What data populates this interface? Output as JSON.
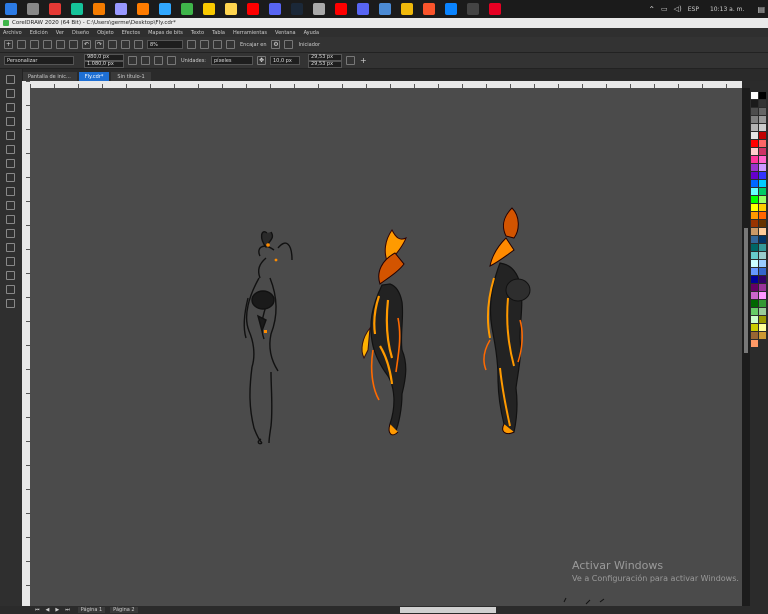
{
  "taskbar": {
    "icons": [
      "windows-icon",
      "search-icon",
      "record-icon",
      "grammarly-icon",
      "blender-icon",
      "after-effects-icon",
      "illustrator-icon",
      "photoshop-icon",
      "coreldraw-icon",
      "file-explorer-icon",
      "sticky-notes-icon",
      "youtube-icon",
      "discord-icon",
      "steam-icon",
      "github-icon",
      "youtube-icon",
      "discord-icon",
      "qbittorrent-icon",
      "binance-icon",
      "brave-icon",
      "edge-icon",
      "obs-icon",
      "pinterest-icon"
    ],
    "lang": "ESP",
    "time": "10:13 a. m."
  },
  "window": {
    "title": "CorelDRAW 2020 (64 Bit) - C:\\Users\\germe\\Desktop\\Fly.cdr*"
  },
  "menu": [
    "Archivo",
    "Edición",
    "Ver",
    "Diseño",
    "Objeto",
    "Efectos",
    "Mapas de bits",
    "Texto",
    "Tabla",
    "Herramientas",
    "Ventana",
    "Ayuda"
  ],
  "standard_toolbar": {
    "zoom": "8%",
    "snap": "Encajar en",
    "launch": "Iniciador"
  },
  "property_bar": {
    "preset": "Personalizar",
    "width": "980,0 px",
    "height": "1.080,0 px",
    "units_label": "Unidades:",
    "units": "píxeles",
    "nudge": "10,0 px",
    "dup_x": "29,53 px",
    "dup_y": "29,53 px"
  },
  "tabs": [
    {
      "label": "Pantalla de inic...",
      "active": false
    },
    {
      "label": "Fly.cdr*",
      "active": true
    },
    {
      "label": "Sin título-1",
      "active": false
    }
  ],
  "status": {
    "pages": [
      "Página 1",
      "Página 2"
    ]
  },
  "watermark": {
    "title": "Activar Windows",
    "subtitle": "Ve a Configuración para activar Windows."
  },
  "palette_colors": [
    "#ffffff",
    "#000000",
    "#1a1a1a",
    "#333333",
    "#4d4d4d",
    "#666666",
    "#808080",
    "#999999",
    "#b3b3b3",
    "#cccccc",
    "#e6e6e6",
    "#c00000",
    "#ff0000",
    "#ff6666",
    "#ffcccc",
    "#cc3366",
    "#ff3399",
    "#ff66cc",
    "#9933cc",
    "#cc99ff",
    "#6600cc",
    "#3333ff",
    "#0066ff",
    "#00ccff",
    "#66ffff",
    "#00cc66",
    "#00ff00",
    "#99ff66",
    "#ffff00",
    "#ffcc00",
    "#ff9900",
    "#ff6600",
    "#993300",
    "#663300",
    "#cc9966",
    "#ffcc99",
    "#336699",
    "#003366",
    "#006666",
    "#339999",
    "#66cccc",
    "#99cccc",
    "#ccffff",
    "#99ccff",
    "#6699ff",
    "#3366cc",
    "#000099",
    "#330066",
    "#660066",
    "#993399",
    "#cc66cc",
    "#ff99ff",
    "#006600",
    "#339933",
    "#66cc66",
    "#99cc99",
    "#ccffcc",
    "#999900",
    "#cccc00",
    "#ffff99",
    "#996633",
    "#cc9933",
    "#ff9966"
  ]
}
